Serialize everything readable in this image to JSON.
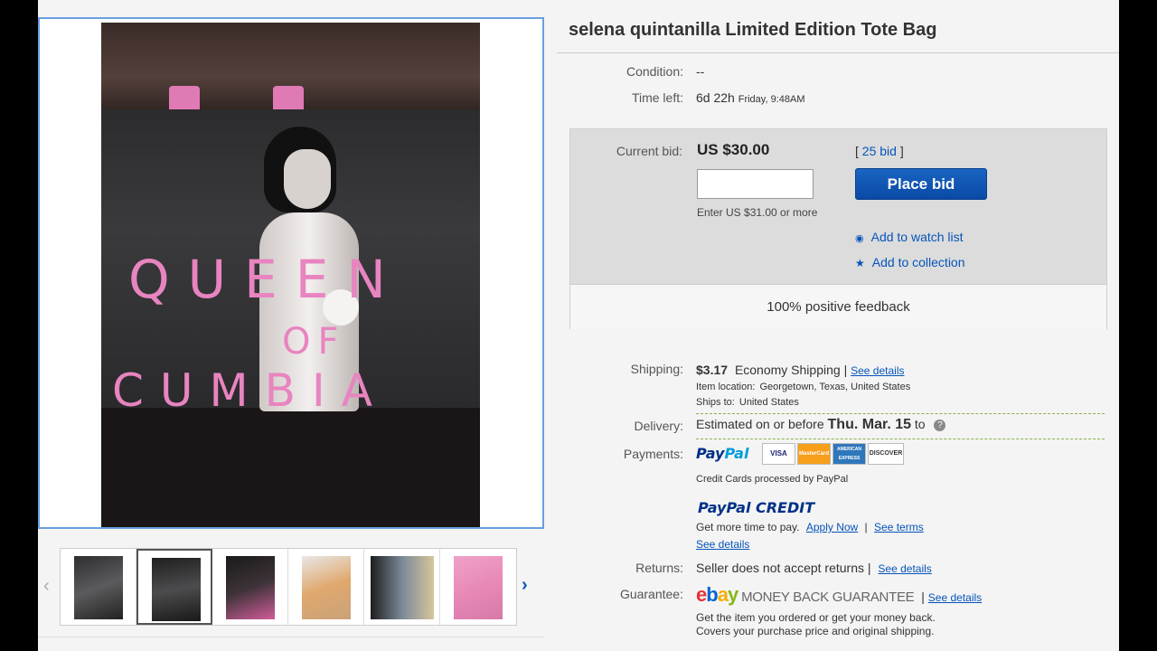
{
  "item": {
    "title": "selena quintanilla Limited Edition Tote Bag",
    "photo_text": {
      "queen": "QUEEN",
      "of": "OF",
      "cumbia": "CUMBIA"
    }
  },
  "condition": {
    "label": "Condition:",
    "value": "--"
  },
  "time_left": {
    "label": "Time left:",
    "value": "6d 22h",
    "end": "Friday, 9:48AM"
  },
  "bid": {
    "label": "Current bid:",
    "price": "US $30.00",
    "bid_count_prefix": "[ ",
    "bid_count": "25 bid",
    "bid_count_suffix": " ]",
    "input_value": "",
    "hint": "Enter US $31.00 or more",
    "place_bid": "Place bid",
    "watch": "Add to watch list",
    "collection": "Add to collection",
    "feedback": "100% positive feedback"
  },
  "shipping": {
    "label": "Shipping:",
    "cost": "$3.17",
    "method": "Economy Shipping",
    "separator": "|",
    "details_link": "See details",
    "location_label": "Item location:",
    "location": "Georgetown, Texas, United States",
    "ships_to_label": "Ships to:",
    "ships_to": "United States"
  },
  "delivery": {
    "label": "Delivery:",
    "prefix": "Estimated on or before",
    "date": "Thu. Mar. 15",
    "suffix": "to",
    "help": "?"
  },
  "payments": {
    "label": "Payments:",
    "paypal_a": "Pay",
    "paypal_b": "Pal",
    "cards": [
      "VISA",
      "MasterCard",
      "AMERICAN EXPRESS",
      "DISCOVER"
    ],
    "note": "Credit Cards processed by PayPal",
    "credit_logo": "PayPal CREDIT",
    "credit_text": "Get more time to pay.",
    "apply_now": "Apply Now",
    "see_terms": "See terms",
    "see_details": "See details"
  },
  "returns": {
    "label": "Returns:",
    "value": "Seller does not accept returns",
    "link": "See details"
  },
  "guarantee": {
    "label": "Guarantee:",
    "logo_e": "e",
    "logo_b": "b",
    "logo_a": "a",
    "logo_y": "y",
    "text": "MONEY BACK GUARANTEE",
    "link": "See details",
    "line1": "Get the item you ordered or get your money back.",
    "line2": "Covers your purchase price and original shipping."
  },
  "colors": {
    "link": "#0654ba",
    "button": "#0a4aa6",
    "paypal_dark": "#003087",
    "paypal_light": "#009cde"
  },
  "icons": [
    "eye-icon",
    "star-icon",
    "chevron-left-icon",
    "chevron-right-icon",
    "help-icon"
  ]
}
